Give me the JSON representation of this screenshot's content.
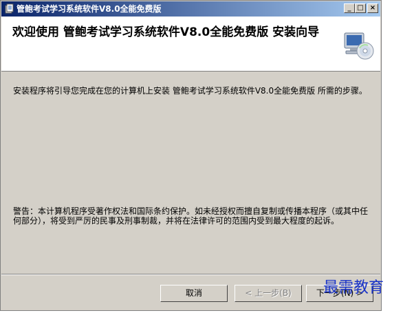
{
  "window": {
    "title": "管鲍考试学习系统软件V8.0全能免费版",
    "minimize_glyph": "_",
    "maximize_glyph": "□",
    "close_glyph": "×"
  },
  "header": {
    "title": "欢迎使用 管鲍考试学习系统软件V8.0全能免费版 安装向导",
    "icon": "computer-cd-icon"
  },
  "body": {
    "intro": "安装程序将引导您完成在您的计算机上安装 管鲍考试学习系统软件V8.0全能免费版 所需的步骤。",
    "warning": "警告：本计算机程序受著作权法和国际条约保护。如未经授权而擅自复制或传播本程序（或其中任何部分），将受到严厉的民事及刑事制裁，并将在法律许可的范围内受到最大程度的起诉。"
  },
  "buttons": {
    "cancel": "取消",
    "back": "< 上一步(B)",
    "next": "下一步(N) >"
  },
  "watermark": "最需教育",
  "colors": {
    "titlebar_start": "#0a246a",
    "titlebar_end": "#a6caf0",
    "dialog_bg": "#d4d0c8",
    "watermark": "#1a34c8"
  }
}
